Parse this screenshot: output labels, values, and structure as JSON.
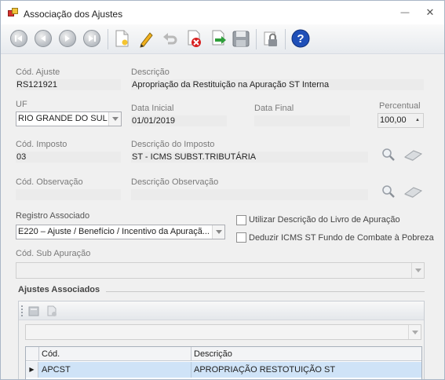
{
  "window": {
    "title": "Associação dos Ajustes",
    "minimize_glyph": "—",
    "close_glyph": "✕"
  },
  "toolbar": {
    "buttons": [
      "first-record",
      "previous-record",
      "next-record",
      "last-record",
      "new-document",
      "edit",
      "undo",
      "delete",
      "save-and-exit",
      "save",
      "lock",
      "help"
    ]
  },
  "form": {
    "cod_ajuste": {
      "label": "Cód. Ajuste",
      "value": "RS121921"
    },
    "descricao": {
      "label": "Descrição",
      "value": "Apropriação da Restituição na Apuração ST Interna"
    },
    "uf": {
      "label": "UF",
      "value": "RIO GRANDE DO SUL"
    },
    "data_inicial": {
      "label": "Data Inicial",
      "value": "01/01/2019"
    },
    "data_final": {
      "label": "Data Final",
      "value": ""
    },
    "percentual": {
      "label": "Percentual",
      "value": "100,00"
    },
    "cod_imposto": {
      "label": "Cód. Imposto",
      "value": "03"
    },
    "descricao_imposto": {
      "label": "Descrição do Imposto",
      "value": "ST - ICMS SUBST.TRIBUTÁRIA"
    },
    "cod_observacao": {
      "label": "Cód. Observação",
      "value": ""
    },
    "descricao_observacao": {
      "label": "Descrição Observação",
      "value": ""
    },
    "registro_associado": {
      "label": "Registro Associado",
      "value": "E220 – Ajuste / Benefício / Incentivo da Apuraçã..."
    },
    "utilizar_descricao": {
      "label": "Utilizar Descrição do Livro de Apuração",
      "checked": false
    },
    "deduzir_icms": {
      "label": "Deduzir ICMS ST Fundo de Combate à Pobreza",
      "checked": false
    },
    "cod_sub_apuracao": {
      "label": "Cód. Sub Apuração",
      "value": ""
    }
  },
  "ajustes_associados": {
    "title": "Ajustes Associados",
    "columns": [
      "Cód.",
      "Descrição"
    ],
    "rows": [
      {
        "cod": "APCST",
        "descricao": "APROPRIAÇÃO RESTOTUIÇÃO ST"
      }
    ],
    "row_indicator": "▶"
  }
}
